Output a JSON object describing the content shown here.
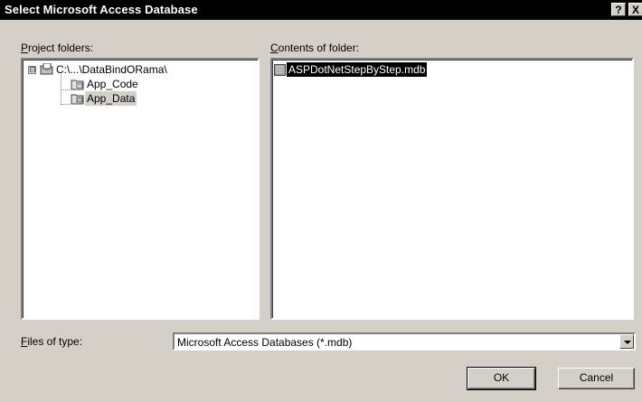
{
  "window": {
    "title": "Select Microsoft Access Database",
    "help_label": "?",
    "close_label": "X"
  },
  "project_folders": {
    "label_accel": "P",
    "label_rest": "roject folders:",
    "tree": [
      {
        "label": "C:\\...\\DataBindORama\\",
        "expander": "⊟",
        "icon": "project-folder-icon"
      },
      {
        "label": "App_Code",
        "icon": "folder-icon"
      },
      {
        "label": "App_Data",
        "icon": "folder-icon",
        "selected": true
      }
    ]
  },
  "contents": {
    "label_accel": "C",
    "label_rest": "ontents of folder:",
    "items": [
      {
        "label": "ASPDotNetStepByStep.mdb",
        "icon": "database-file-icon",
        "selected": true
      }
    ]
  },
  "file_type": {
    "label_accel": "F",
    "label_rest": "iles of type:",
    "selected_value": "Microsoft Access Databases (*.mdb)"
  },
  "buttons": {
    "ok": "OK",
    "cancel": "Cancel"
  }
}
